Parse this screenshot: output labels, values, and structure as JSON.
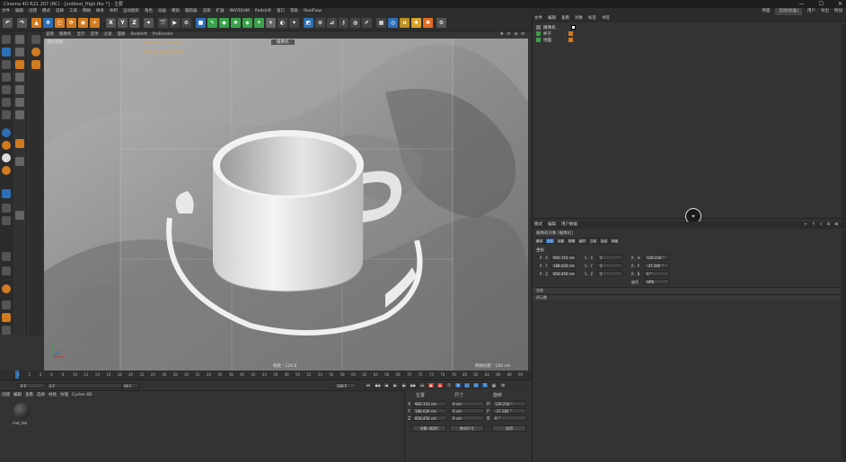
{
  "window": {
    "title": "Cinema 4D R21.207 (RC) - [ordbest_High.fbx *] - 主要",
    "buttons": [
      "—",
      "☐",
      "✕"
    ]
  },
  "menubar": {
    "items": [
      "文件",
      "编辑",
      "创建",
      "模式",
      "选择",
      "工具",
      "网格",
      "样条",
      "体积",
      "运动图形",
      "角色",
      "动画",
      "模拟",
      "跟踪器",
      "渲染",
      "扩展",
      "INSYDIUM",
      "Redshift",
      "窗口",
      "帮助",
      "RealFlow"
    ],
    "right": [
      "界面",
      "启动(标准)",
      "用户",
      "导出",
      "附加"
    ]
  },
  "toolbar": {
    "axis_buttons": [
      "X",
      "Y",
      "Z"
    ]
  },
  "viewport": {
    "menu": [
      "查看",
      "摄像机",
      "显示",
      "选项",
      "过滤",
      "面板",
      "Redshift",
      "ProRender"
    ],
    "label": "透视视图",
    "selector": "摄像机",
    "hud_vertices": "Number of emitters: 0",
    "hud_particles": "Total live particles: 0",
    "distance": "视距 : 124.8",
    "grid": "网格间距 : 100 cm",
    "corner_icons": [
      "✥",
      "⟳",
      "⊕",
      "⊡"
    ]
  },
  "timeline": {
    "ticks": [
      "0",
      "2",
      "4",
      "6",
      "8",
      "10",
      "12",
      "14",
      "16",
      "18",
      "20",
      "22",
      "24",
      "26",
      "28",
      "30",
      "32",
      "34",
      "36",
      "38",
      "40",
      "42",
      "44",
      "46",
      "48",
      "50",
      "52",
      "54",
      "56",
      "58",
      "60",
      "62",
      "64",
      "66",
      "68",
      "70",
      "72",
      "74",
      "76",
      "78",
      "80",
      "82",
      "84",
      "86",
      "88",
      "90"
    ],
    "current_frame": "0 F",
    "start": "0 F",
    "end_a": "90 F",
    "end_b": "100 F"
  },
  "material_manager": {
    "tabs": [
      "创建",
      "编辑",
      "查看",
      "选择",
      "材质",
      "纹理",
      "Cycles 4D"
    ],
    "material_name": "mat_tex"
  },
  "coordinates": {
    "headers": [
      "位置",
      "尺寸",
      "旋转"
    ],
    "rows": [
      {
        "axis": "X",
        "pos": "902.151 cm",
        "size": "0 cm",
        "rot_label": "H",
        "rot": "126.216 °"
      },
      {
        "axis": "Y",
        "pos": "188.026 cm",
        "size": "0 cm",
        "rot_label": "P",
        "rot": "-37.285 °"
      },
      {
        "axis": "Z",
        "pos": "858.456 cm",
        "size": "0 cm",
        "rot_label": "B",
        "rot": "0 °"
      }
    ],
    "mode": "对象 (相对)",
    "size_mode": "绝对尺寸",
    "apply": "应用"
  },
  "object_manager": {
    "tabs": [
      "文件",
      "编辑",
      "查看",
      "对象",
      "标签",
      "书签"
    ],
    "objects": [
      {
        "name": "摄像机",
        "icon": "camera-icon"
      },
      {
        "name": "杯子",
        "icon": "null-icon"
      },
      {
        "name": "地面",
        "icon": "null-icon"
      }
    ]
  },
  "attributes": {
    "tabs": [
      "模式",
      "编辑",
      "用户数据"
    ],
    "object_title": "摄像机对象 [摄像机]",
    "subtabs": [
      "基本",
      "坐标",
      "对象",
      "物理",
      "细节",
      "立体",
      "合成",
      "球面"
    ],
    "section": "坐标",
    "rows": [
      {
        "p_label": "P . X",
        "p": "902.151 cm",
        "s_label": "S . X",
        "s": "1",
        "r_label": "R . H",
        "r": "126.216 °"
      },
      {
        "p_label": "P . Y",
        "p": "188.026 cm",
        "s_label": "S . Y",
        "s": "1",
        "r_label": "R . P",
        "r": "-37.285 °"
      },
      {
        "p_label": "P . Z",
        "p": "858.456 cm",
        "s_label": "S . Z",
        "s": "1",
        "r_label": "R . B",
        "r": "0 °"
      }
    ],
    "order_label": "顺序",
    "order_value": "HPB",
    "collapsed": [
      "冻结",
      "四元数"
    ]
  },
  "colors": {
    "accent": "#2d6fb7",
    "hud": "#e1a94c",
    "record": "#d03a2f"
  }
}
